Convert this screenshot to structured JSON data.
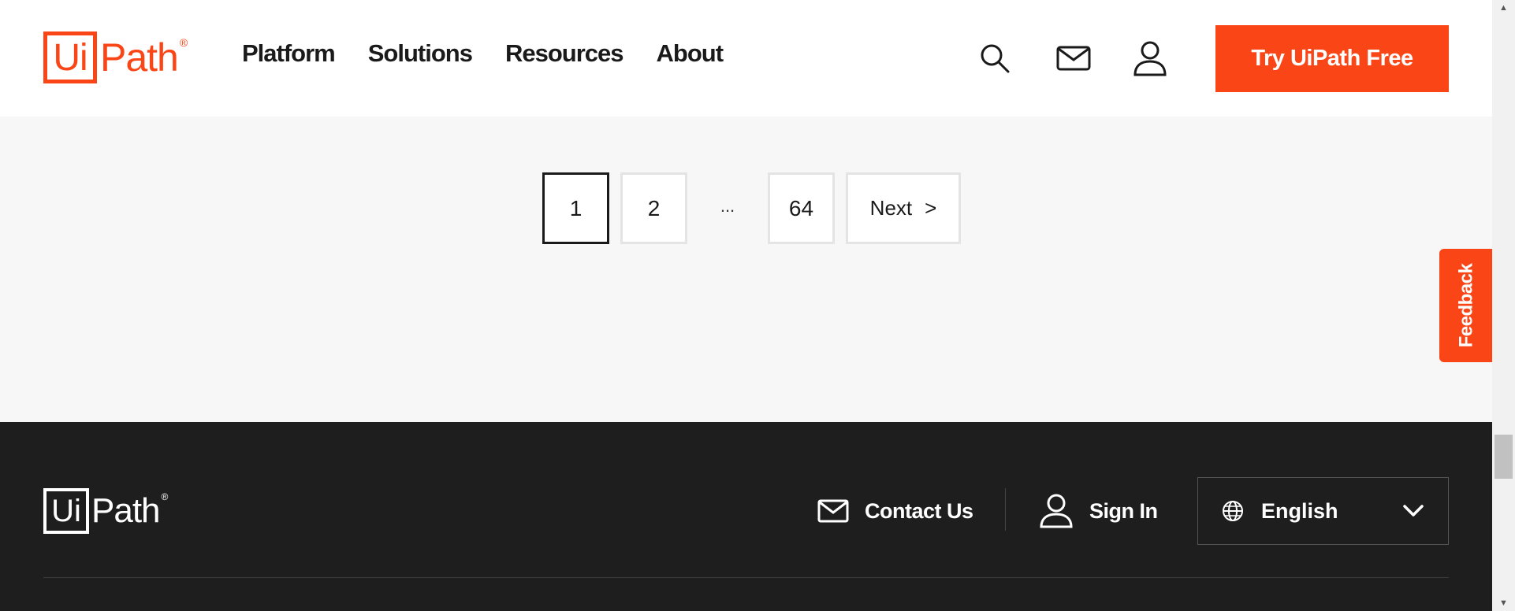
{
  "header": {
    "logo": {
      "box_text": "Ui",
      "word": "Path",
      "reg": "®"
    },
    "nav": [
      {
        "label": "Platform"
      },
      {
        "label": "Solutions"
      },
      {
        "label": "Resources"
      },
      {
        "label": "About"
      }
    ],
    "icons": [
      "search-icon",
      "mail-icon",
      "user-icon"
    ],
    "cta_label": "Try UiPath Free"
  },
  "pagination": {
    "current": "1",
    "page_2": "2",
    "ellipsis": "...",
    "last": "64",
    "next_label": "Next",
    "next_arrow": ">"
  },
  "feedback_label": "Feedback",
  "footer": {
    "logo": {
      "box_text": "Ui",
      "word": "Path",
      "reg": "®"
    },
    "contact_label": "Contact Us",
    "signin_label": "Sign In",
    "language": "English"
  },
  "colors": {
    "brand": "#fa4616",
    "footer_bg": "#1e1e1e",
    "page_bg": "#f7f7f7"
  }
}
